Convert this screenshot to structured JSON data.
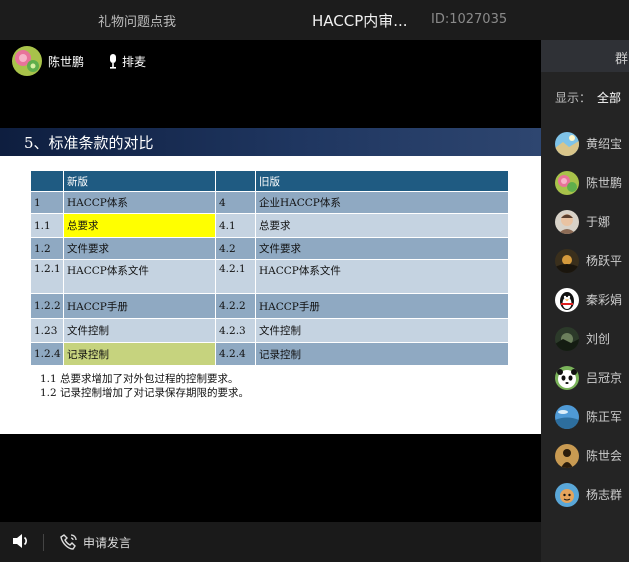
{
  "topbar": {
    "gift_label": "礼物问题点我",
    "title": "HACCP内审...",
    "room_id": "ID:1027035"
  },
  "presenter": {
    "name": "陈世鹏",
    "mic_label": "排麦"
  },
  "slide": {
    "title": "5、标准条款的对比",
    "table": {
      "headers": [
        "",
        "新版",
        "",
        "旧版"
      ],
      "rows": [
        [
          "1",
          "HACCP体系",
          "4",
          "企业HACCP体系"
        ],
        [
          "1.1",
          "总要求",
          "4.1",
          "总要求"
        ],
        [
          "1.2",
          "文件要求",
          "4.2",
          "文件要求"
        ],
        [
          "1.2.1",
          "HACCP体系文件",
          "4.2.1",
          "HACCP体系文件"
        ],
        [
          "1.2.2",
          "HACCP手册",
          "4.2.2",
          "HACCP手册"
        ],
        [
          "1.23",
          "文件控制",
          "4.2.3",
          "文件控制"
        ],
        [
          "1.2.4",
          "记录控制",
          "4.2.4",
          "记录控制"
        ]
      ],
      "highlight_colors": {
        "yellow": "#ffff00",
        "olive": "#c6d37e"
      }
    },
    "notes": [
      "1.1 总要求增加了对外包过程的控制要求。",
      "1.2 记录控制增加了对记录保存期限的要求。"
    ]
  },
  "bottombar": {
    "apply_label": "申请发言"
  },
  "sidepanel": {
    "tab_label": "群",
    "filter_label": "显示：",
    "filter_value": "全部",
    "members": [
      {
        "name": "黄绍宝",
        "avatar": "landscape-avatar-icon"
      },
      {
        "name": "陈世鹏",
        "avatar": "flower-avatar-icon"
      },
      {
        "name": "于娜",
        "avatar": "portrait-avatar-icon"
      },
      {
        "name": "杨跃平",
        "avatar": "night-avatar-icon"
      },
      {
        "name": "秦彩娟",
        "avatar": "qq-penguin-avatar-icon"
      },
      {
        "name": "刘创",
        "avatar": "dark-landscape-avatar-icon"
      },
      {
        "name": "吕冠京",
        "avatar": "panda-avatar-icon"
      },
      {
        "name": "陈正军",
        "avatar": "sky-avatar-icon"
      },
      {
        "name": "陈世会",
        "avatar": "silhouette-avatar-icon"
      },
      {
        "name": "杨志群",
        "avatar": "cartoon-avatar-icon"
      }
    ]
  }
}
